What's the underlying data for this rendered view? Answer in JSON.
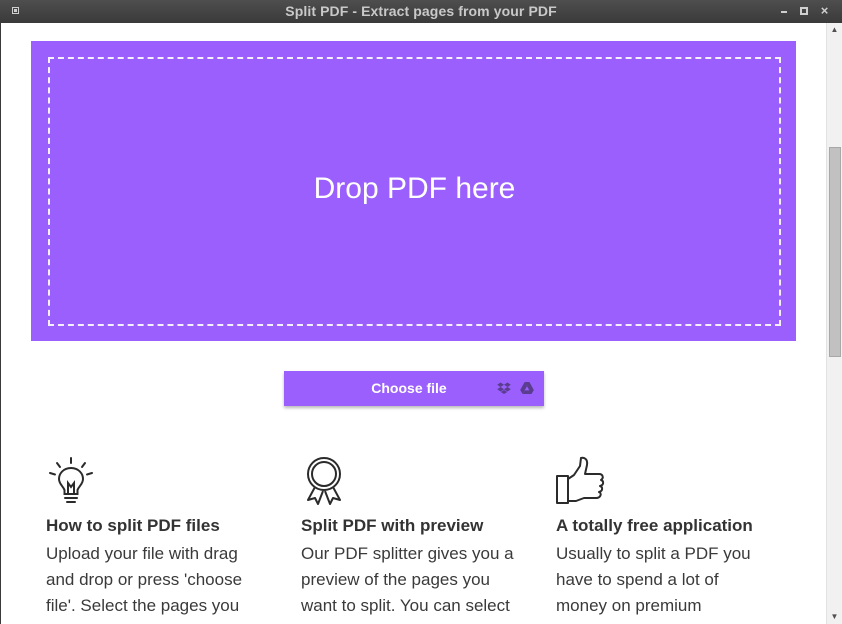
{
  "window": {
    "title": "Split PDF - Extract pages from your PDF"
  },
  "dropzone": {
    "label": "Drop PDF here"
  },
  "upload": {
    "choose_label": "Choose file",
    "icons": [
      "dropbox-icon",
      "google-drive-icon"
    ]
  },
  "features": [
    {
      "icon": "lightbulb-icon",
      "title": "How to split PDF files",
      "text": "Upload your file with drag and drop or press 'choose file'. Select the pages you want to"
    },
    {
      "icon": "award-ribbon-icon",
      "title": "Split PDF with preview",
      "text": "Our PDF splitter gives you a preview of the pages you want to split. You can select pages"
    },
    {
      "icon": "thumbs-up-icon",
      "title": "A totally free application",
      "text": "Usually to split a PDF you have to spend a lot of money on premium software. We"
    }
  ],
  "colors": {
    "accent": "#9b5ffe",
    "titlebar": "#3d3d3d",
    "text": "#333333"
  }
}
